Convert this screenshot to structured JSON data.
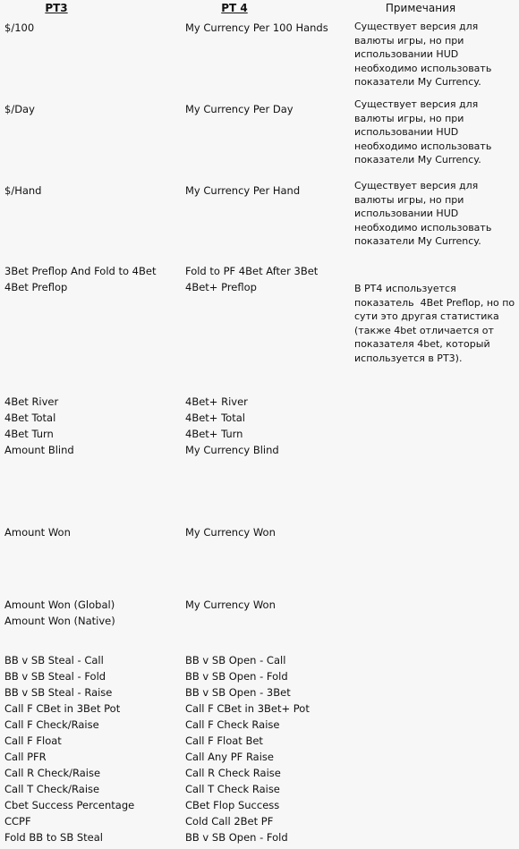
{
  "headers": {
    "pt3": "PT3",
    "pt4": "PT 4",
    "notes": "Примечания"
  },
  "notes_text": {
    "my_currency": "Существует версия для валюты игры, но при использовании HUD необходимо использовать показатели My Currency.",
    "fourbet_preflop": "В PT4 используется показатель  4Bet Preflop, но по сути это другая статистика (также 4bet отличается от показателя 4bet, который используется в PT3)."
  },
  "blocks": [
    {
      "id": "per-100-hands",
      "pt3": [
        "$/100"
      ],
      "pt4": [
        "My Currency Per 100 Hands"
      ],
      "note_key": "my_currency"
    },
    {
      "id": "per-day",
      "pt3": [
        "$/Day"
      ],
      "pt4": [
        "My Currency Per Day"
      ],
      "note_key": "my_currency"
    },
    {
      "id": "per-hand",
      "pt3": [
        "$/Hand"
      ],
      "pt4": [
        "My Currency Per Hand"
      ],
      "note_key": "my_currency"
    },
    {
      "id": "fourbet-preflop",
      "pt3": [
        "3Bet Preflop And Fold to 4Bet",
        "4Bet Preflop"
      ],
      "pt4": [
        "Fold to PF 4Bet After 3Bet",
        "4Bet+ Preflop"
      ],
      "note_key": "fourbet_preflop"
    },
    {
      "id": "fourbet-streets",
      "pt3": [
        "4Bet River",
        "4Bet Total",
        "4Bet Turn",
        "Amount Blind"
      ],
      "pt4": [
        "4Bet+ River",
        "4Bet+ Total",
        "4Bet+ Turn",
        "My Currency Blind"
      ],
      "note_key": null
    },
    {
      "id": "amount-won",
      "pt3": [
        "Amount Won"
      ],
      "pt4": [
        "My Currency Won"
      ],
      "note_key": null
    },
    {
      "id": "amount-won-global-native",
      "pt3": [
        "Amount Won (Global)",
        "Amount Won (Native)"
      ],
      "pt4": [
        "My Currency Won"
      ],
      "note_key": null
    }
  ],
  "mapping_list": [
    {
      "pt3": "BB v SB Steal - Call",
      "pt4": "BB v SB Open - Call"
    },
    {
      "pt3": "BB v SB Steal - Fold",
      "pt4": "BB v SB Open - Fold"
    },
    {
      "pt3": "BB v SB Steal - Raise",
      "pt4": "BB v SB Open - 3Bet"
    },
    {
      "pt3": "Call F CBet in 3Bet Pot",
      "pt4": "Call F CBet in 3Bet+ Pot"
    },
    {
      "pt3": "Call F Check/Raise",
      "pt4": "Call F Check Raise"
    },
    {
      "pt3": "Call F Float",
      "pt4": "Call F Float Bet"
    },
    {
      "pt3": "Call PFR",
      "pt4": "Call Any PF Raise"
    },
    {
      "pt3": "Call R Check/Raise",
      "pt4": "Call R Check Raise"
    },
    {
      "pt3": "Call T Check/Raise",
      "pt4": "Call T Check Raise"
    },
    {
      "pt3": "Cbet Success Percentage",
      "pt4": "CBet Flop Success"
    },
    {
      "pt3": "CCPF",
      "pt4": "Cold Call 2Bet PF"
    },
    {
      "pt3": "Fold BB to SB Steal",
      "pt4": "BB v SB Open - Fold"
    }
  ],
  "colors": {
    "background": "#f7f7f7",
    "text": "#111111"
  }
}
